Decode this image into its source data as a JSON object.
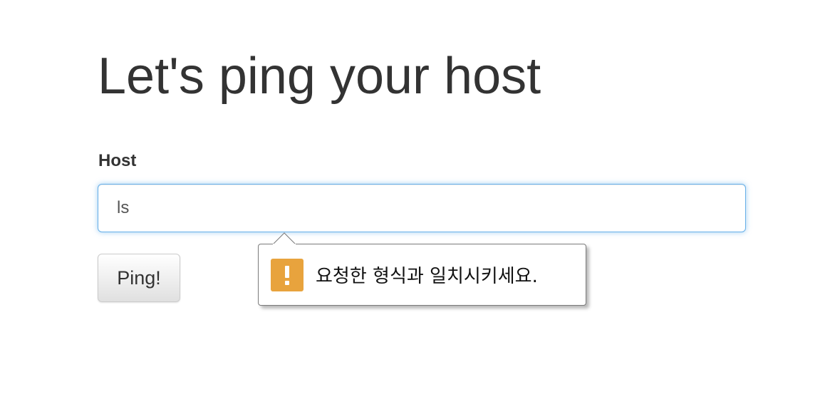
{
  "page": {
    "title": "Let's ping your host"
  },
  "form": {
    "host_label": "Host",
    "host_value": "ls",
    "ping_button_label": "Ping!"
  },
  "validation_tooltip": {
    "icon": "warning-icon",
    "message": "요청한 형식과 일치시키세요.",
    "icon_color": "#e8a33d"
  },
  "colors": {
    "focus_border": "#66afe9",
    "text": "#333333"
  }
}
